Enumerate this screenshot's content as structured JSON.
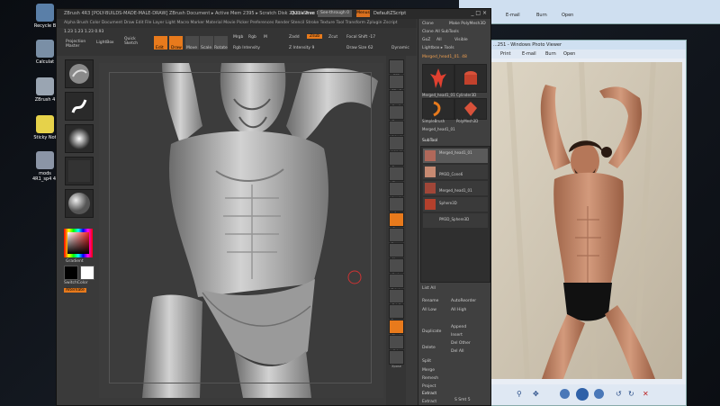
{
  "desktop": {
    "icons": [
      {
        "label": "Recycle B",
        "color": "#5a7fa8"
      },
      {
        "label": "Calculat",
        "color": "#7a8fa6"
      },
      {
        "label": "ZBrush 4",
        "color": "#9aa5b2"
      },
      {
        "label": "Sticky Not",
        "color": "#e6d24a"
      },
      {
        "label": "mods",
        "sub": "4R1_sp4 4K",
        "color": "#8b95a6"
      }
    ]
  },
  "zbrush": {
    "title": "ZBrush 4R3   [POLY-BUILDS-MADE-MALE-DRAW]   ZBrush Document   ▸ Active Mem 2395  ▸ Scratch Disk 2823 ▸ Free Mem",
    "quicksave": "QuickSave",
    "seethrough": "See-through  0",
    "menus": "Menus",
    "defaultscript": "DefaultZScript",
    "window_controls": "_ □ ×",
    "menu_items": "Alpha  Brush  Color  Document  Draw  Edit  File  Layer  Light  Macro  Marker  Material  Movie  Picker  Preferences  Render  Stencil  Stroke  Texture  Tool  Transform  Zplugin  Zscript",
    "toolbar": {
      "coords": "1.23 1.23 1.23 0.93",
      "projection_master": "Projection Master",
      "lightbox": "LightBox",
      "quick_sketch": "Quick Sketch",
      "edit": "Edit",
      "draw": "Draw",
      "move": "Move",
      "scale": "Scale",
      "rotate": "Rotate",
      "mrgb": "Mrgb",
      "rgb": "Rgb",
      "m": "M",
      "zadd": "Zadd",
      "zsub": "Zsub",
      "zcut": "Zcut",
      "rgb_intensity": "Rgb Intensity",
      "z_intensity": "Z Intensity  9",
      "focal_shift": "Focal Shift  -17",
      "draw_size": "Draw Size  62",
      "dynamic": "Dynamic"
    },
    "brushes": [
      "Clay",
      "Stroke",
      "Alpha",
      "Texture",
      "Material"
    ],
    "gradient_label": "Gradient",
    "switchcolor_label": "SwitchColor",
    "alternate_label": "Alternate",
    "right_shelf": [
      {
        "label": "BPR",
        "on": false
      },
      {
        "label": "SPix 3",
        "on": false
      },
      {
        "label": "Scroll",
        "on": false
      },
      {
        "label": "Zoom",
        "on": false
      },
      {
        "label": "Actual",
        "on": false
      },
      {
        "label": "AAHalf",
        "on": false
      },
      {
        "label": "Persp",
        "on": false
      },
      {
        "label": "Floor",
        "on": false
      },
      {
        "label": "Local",
        "on": false
      },
      {
        "label": "L.Sym",
        "on": false
      },
      {
        "label": "Gxyz",
        "on": true
      },
      {
        "label": "Frame",
        "on": false
      },
      {
        "label": "Move",
        "on": false
      },
      {
        "label": "Scale",
        "on": false
      },
      {
        "label": "Rotate",
        "on": false
      },
      {
        "label": "PolyF",
        "on": false
      },
      {
        "label": "Transp",
        "on": false
      },
      {
        "label": "Ghost",
        "on": true
      },
      {
        "label": "Solo",
        "on": false
      },
      {
        "label": "Xpose",
        "on": false
      }
    ],
    "palette": {
      "clone": "Clone",
      "make_polymesh": "Make PolyMesh3D",
      "clone_all_subtools": "Clone All SubTools",
      "goz": "GoZ",
      "all": "All",
      "visible": "Visible",
      "lightbox_tools": "Lightbox ▸ Tools",
      "tool_name": "Merged_head1_01. 48",
      "tool_thumbs": [
        "Merged_head1_01",
        "Cylinder3D",
        "PolyMesh3D",
        "SimpleBrush",
        "Merged_head1_01"
      ],
      "subtool": "SubTool",
      "subtools": [
        "Merged_head1_01",
        "PM3D_Cone6",
        "Merged_head1_01",
        "Sphere3D",
        "PM3D_Sphere3D"
      ],
      "list_all": "List All",
      "rename": "Rename",
      "autoreorder": "AutoReorder",
      "all_low": "All Low",
      "all_high": "All High",
      "duplicate": "Duplicate",
      "append": "Append",
      "insert": "Insert",
      "del_other": "Del Other",
      "delete": "Delete",
      "del_all": "Del All",
      "split": "Split",
      "merge": "Merge",
      "remesh": "Remesh",
      "project": "Project",
      "extract": "Extract",
      "extract_btn": "Extract",
      "s_smt": "S Smt 5",
      "thick": "Thick 0.02"
    }
  },
  "photoviewer": {
    "title": "...251 - Windows Photo Viewer",
    "menu": [
      "Print",
      "E-mail",
      "Burn",
      "Open"
    ]
  },
  "photoviewer2": {
    "menu": [
      "E-mail",
      "Burn",
      "Open"
    ]
  }
}
